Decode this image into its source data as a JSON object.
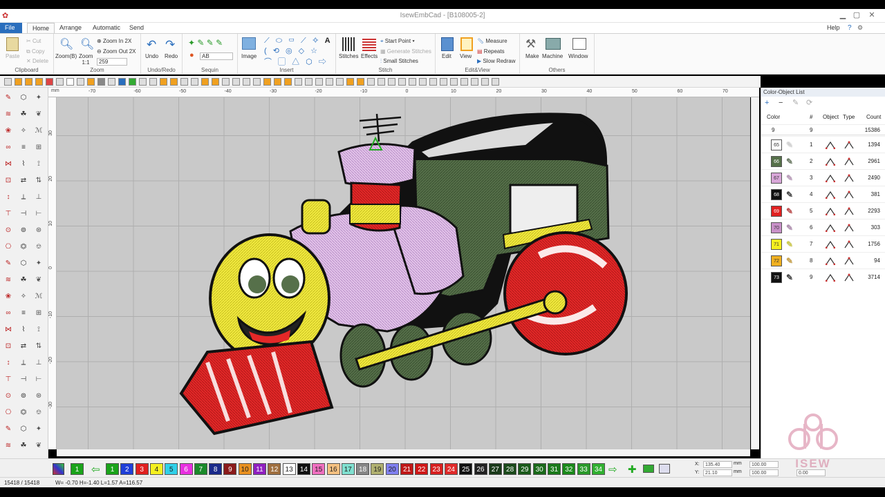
{
  "app": {
    "title": "IsewEmbCad - [B108005-2]"
  },
  "menu": {
    "tabs": [
      "File",
      "Home",
      "Arrange",
      "Automatic",
      "Send"
    ],
    "help": "Help"
  },
  "ribbon": {
    "clipboard": {
      "label": "Clipboard",
      "paste": "Paste",
      "cut": "Cut",
      "copy": "Copy",
      "delete": "Delete"
    },
    "zoom": {
      "label": "Zoom",
      "zoom_b": "Zoom(B)",
      "zoom_11": "Zoom 1:1",
      "zoom_in": "Zoom In 2X",
      "zoom_out": "Zoom Out 2X",
      "zoom_value": "259"
    },
    "undoredo": {
      "label": "Undo/Redo",
      "undo": "Undo",
      "redo": "Redo"
    },
    "sequin": {
      "label": "Sequin",
      "value": "AB"
    },
    "insert": {
      "label": "Insert",
      "image": "Image"
    },
    "stitch": {
      "label": "Stitch",
      "stitches": "Stitches",
      "effects": "Effects",
      "start_point": "Start Point",
      "generate": "Generate Stitches",
      "small": "Small Stitches"
    },
    "editview": {
      "label": "Edit&View",
      "edit": "Edit",
      "view": "View",
      "measure": "Measure",
      "repeats": "Repeats",
      "slow_redraw": "Slow Redraw"
    },
    "others": {
      "label": "Others",
      "make": "Make",
      "machine": "Machine",
      "window": "Window"
    }
  },
  "ruler": {
    "h": [
      "-70",
      "-60",
      "-50",
      "-40",
      "-30",
      "-20",
      "-10",
      "0",
      "10",
      "20",
      "30",
      "40",
      "50",
      "60",
      "70"
    ],
    "hunit": "mm",
    "v": [
      "30",
      "20",
      "10",
      "0",
      "-10",
      "-20",
      "-30"
    ],
    "vunit": "mm"
  },
  "panel": {
    "title": "Color-Object List",
    "headers": [
      "Color",
      "#",
      "Object",
      "Type",
      "Count"
    ],
    "total": {
      "color": "9",
      "num": "9",
      "count": "15386"
    },
    "rows": [
      {
        "color": "65",
        "num": "1",
        "count": "1394",
        "hex": "#ffffff"
      },
      {
        "color": "66",
        "num": "2",
        "count": "2961",
        "hex": "#56704a"
      },
      {
        "color": "67",
        "num": "3",
        "count": "2490",
        "hex": "#d8a6d8"
      },
      {
        "color": "68",
        "num": "4",
        "count": "381",
        "hex": "#111111"
      },
      {
        "color": "69",
        "num": "5",
        "count": "2293",
        "hex": "#e02020"
      },
      {
        "color": "70",
        "num": "6",
        "count": "303",
        "hex": "#c890c8"
      },
      {
        "color": "71",
        "num": "7",
        "count": "1756",
        "hex": "#f5f020"
      },
      {
        "color": "72",
        "num": "8",
        "count": "94",
        "hex": "#f0b020"
      },
      {
        "color": "73",
        "num": "9",
        "count": "3714",
        "hex": "#111111"
      }
    ]
  },
  "colorbar": [
    {
      "n": "1",
      "c": "#1aa31a"
    },
    {
      "n": "2",
      "c": "#1f3fd8"
    },
    {
      "n": "3",
      "c": "#e02020"
    },
    {
      "n": "4",
      "c": "#f5f020",
      "d": 1
    },
    {
      "n": "5",
      "c": "#30d0e8",
      "d": 1
    },
    {
      "n": "6",
      "c": "#e830e0"
    },
    {
      "n": "7",
      "c": "#1a8a2a"
    },
    {
      "n": "8",
      "c": "#1a2a8a"
    },
    {
      "n": "9",
      "c": "#8a1a1a"
    },
    {
      "n": "10",
      "c": "#e89020",
      "d": 1
    },
    {
      "n": "11",
      "c": "#9020c0"
    },
    {
      "n": "12",
      "c": "#a07040"
    },
    {
      "n": "13",
      "c": "#ffffff",
      "d": 1
    },
    {
      "n": "14",
      "c": "#111111"
    },
    {
      "n": "15",
      "c": "#f070c0",
      "d": 1
    },
    {
      "n": "16",
      "c": "#f5c080",
      "d": 1
    },
    {
      "n": "17",
      "c": "#80e0d0",
      "d": 1
    },
    {
      "n": "18",
      "c": "#888888"
    },
    {
      "n": "19",
      "c": "#b0b070",
      "d": 1
    },
    {
      "n": "20",
      "c": "#8080f0",
      "d": 1
    },
    {
      "n": "21",
      "c": "#c01818"
    },
    {
      "n": "22",
      "c": "#d01818"
    },
    {
      "n": "23",
      "c": "#d82020"
    },
    {
      "n": "24",
      "c": "#e02a2a"
    },
    {
      "n": "25",
      "c": "#111111"
    },
    {
      "n": "26",
      "c": "#222222"
    },
    {
      "n": "27",
      "c": "#1a3a1a"
    },
    {
      "n": "28",
      "c": "#1a4a1a"
    },
    {
      "n": "29",
      "c": "#1a5a1a"
    },
    {
      "n": "30",
      "c": "#1a6a1a"
    },
    {
      "n": "31",
      "c": "#1a7a1a"
    },
    {
      "n": "32",
      "c": "#1a8a1a"
    },
    {
      "n": "33",
      "c": "#2a9a2a"
    },
    {
      "n": "34",
      "c": "#30b030"
    }
  ],
  "active_color": "1",
  "coords": {
    "x": "135.40",
    "y": "21.10",
    "w": "100.00",
    "h": "100.00",
    "a": "0.00",
    "unit": "mm",
    "x_label": "X:",
    "y_label": "Y:"
  },
  "status": {
    "count": "15418 / 15418",
    "dims": "W= -0.70 H=-1.40 L=1.57 A=116.57"
  },
  "watermark": "ISEW"
}
